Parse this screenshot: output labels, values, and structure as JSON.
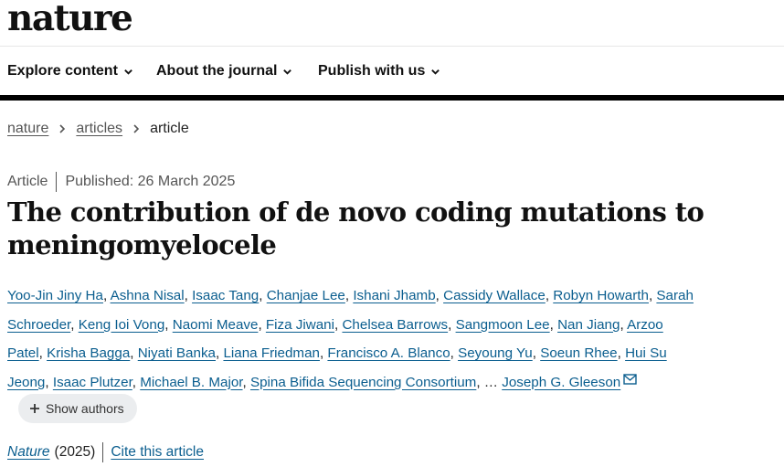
{
  "site": {
    "logo": "nature"
  },
  "nav": {
    "items": [
      {
        "label": "Explore content",
        "icon": "chevron-down-icon"
      },
      {
        "label": "About the journal",
        "icon": "chevron-down-icon"
      },
      {
        "label": "Publish with us",
        "icon": "chevron-down-icon"
      }
    ]
  },
  "breadcrumb": {
    "items": [
      "nature",
      "articles",
      "article"
    ]
  },
  "article": {
    "type": "Article",
    "published": "Published: 26 March 2025",
    "title": "The contribution of de novo coding mutations to meningomyelocele",
    "authors": [
      "Yoo-Jin Jiny Ha",
      "Ashna Nisal",
      "Isaac Tang",
      "Chanjae Lee",
      "Ishani Jhamb",
      "Cassidy Wallace",
      "Robyn Howarth",
      "Sarah Schroeder",
      "Keng Ioi Vong",
      "Naomi Meave",
      "Fiza Jiwani",
      "Chelsea Barrows",
      "Sangmoon Lee",
      "Nan Jiang",
      "Arzoo Patel",
      "Krisha Bagga",
      "Niyati Banka",
      "Liana Friedman",
      "Francisco A. Blanco",
      "Seyoung Yu",
      "Soeun Rhee",
      "Hui Su Jeong",
      "Isaac Plutzer",
      "Michael B. Major",
      "Spina Bifida Sequencing Consortium"
    ],
    "ellipsis": "…",
    "corresponding_author": "Joseph G. Gleeson",
    "show_authors_label": "Show authors",
    "journal": "Nature",
    "year": "(2025)",
    "cite_label": "Cite this article"
  },
  "colors": {
    "link": "#0b5e8f",
    "text": "#222222",
    "chip_bg": "#ebedef"
  }
}
